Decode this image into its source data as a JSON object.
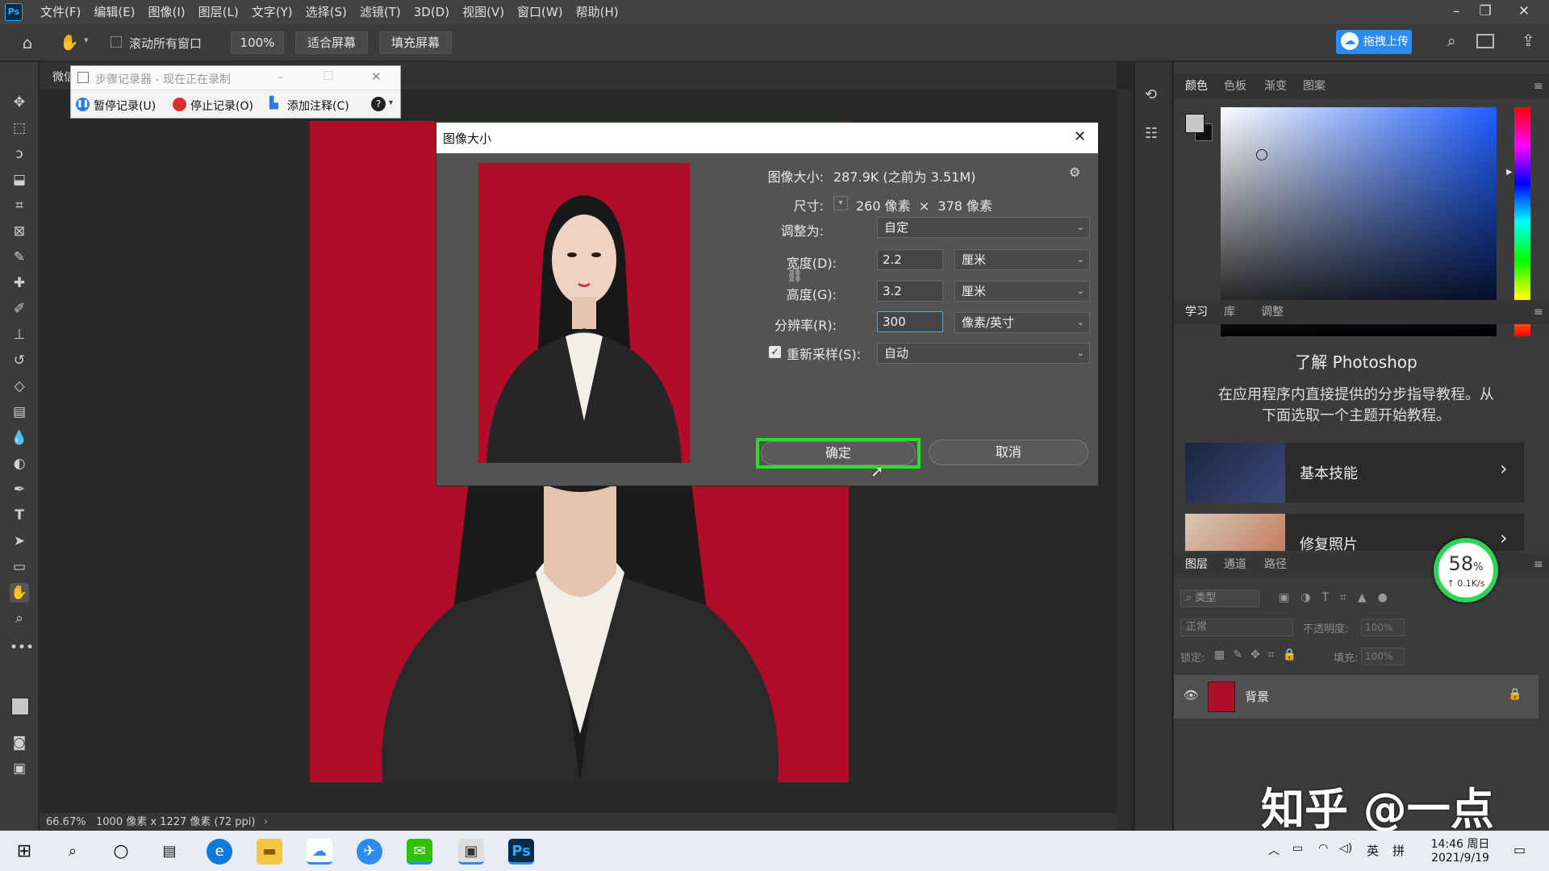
{
  "menubar": {
    "items": [
      "文件(F)",
      "编辑(E)",
      "图像(I)",
      "图层(L)",
      "文字(Y)",
      "选择(S)",
      "滤镜(T)",
      "3D(D)",
      "视图(V)",
      "窗口(W)",
      "帮助(H)"
    ],
    "logo": "Ps"
  },
  "options": {
    "scroll_all": "滚动所有窗口",
    "zoom": "100%",
    "fit_screen": "适合屏幕",
    "fill_screen": "填充屏幕",
    "upload": "拖拽上传"
  },
  "document": {
    "tab": "微信"
  },
  "status": {
    "zoom": "66.67%",
    "info": "1000 像素 x 1227 像素 (72 ppi)"
  },
  "step_recorder": {
    "title": "步骤记录器 - 现在正在录制",
    "pause": "暂停记录(U)",
    "stop": "停止记录(O)",
    "comment": "添加注释(C)"
  },
  "dialog": {
    "title": "图像大小",
    "image_size_label": "图像大小:",
    "image_size_value": "287.9K (之前为 3.51M)",
    "dimensions_label": "尺寸:",
    "dim_w": "260",
    "dim_unit1": "像素",
    "dim_x": "×",
    "dim_h": "378",
    "dim_unit2": "像素",
    "fit_label": "调整为:",
    "fit_value": "自定",
    "width_label": "宽度(D):",
    "width_value": "2.2",
    "width_unit": "厘米",
    "height_label": "高度(G):",
    "height_value": "3.2",
    "height_unit": "厘米",
    "res_label": "分辨率(R):",
    "res_value": "300",
    "res_unit": "像素/英寸",
    "resample_label": "重新采样(S):",
    "resample_value": "自动",
    "ok": "确定",
    "cancel": "取消"
  },
  "panels": {
    "color_tabs": [
      "颜色",
      "色板",
      "渐变",
      "图案"
    ],
    "learn_tabs": [
      "学习",
      "库",
      "调整"
    ],
    "learn_title": "了解 Photoshop",
    "learn_desc1": "在应用程序内直接提供的分步指导教程。从",
    "learn_desc2": "下面选取一个主题开始教程。",
    "card1": "基本技能",
    "card2": "修复照片",
    "layer_tabs": [
      "图层",
      "通道",
      "路径"
    ],
    "layer_filter": "类型",
    "blend_mode": "正常",
    "opacity_label": "不透明度:",
    "opacity_value": "100%",
    "lock_label": "锁定:",
    "fill_label": "填充:",
    "fill_value": "100%",
    "layer_name": "背景",
    "net_percent": "58",
    "net_unit": "%",
    "net_speed": "0.1K/s"
  },
  "watermark": "知乎 @一点",
  "taskbar": {
    "ime": "英",
    "ime2": "拼",
    "time": "14:46 周日",
    "date": "2021/9/19",
    "ps": "Ps"
  },
  "colors": {
    "photo_bg": "#b10d28",
    "ok_highlight": "#1ee51e",
    "ps_blue": "#31a8ff"
  }
}
